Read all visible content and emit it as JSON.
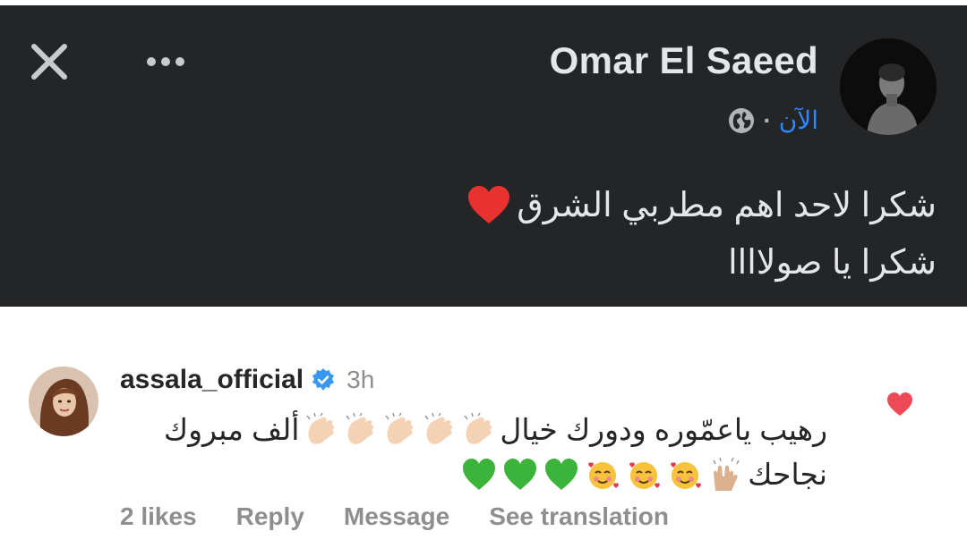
{
  "fb_post": {
    "author": "Omar El Saeed",
    "time": "الآن",
    "separator": "·",
    "line1": "شكرا لاحد اهم مطربي الشرق",
    "line2": "شكرا يا صولاااا",
    "icons": {
      "close": "close-icon",
      "more": "more-icon",
      "privacy": "globe-icon",
      "heart": "red-heart-emoji"
    }
  },
  "comment": {
    "username": "assala_official",
    "time": "3h",
    "line1_text": "رهيب ياعمّوره ودورك خيال",
    "line1_end": "ألف مبروك",
    "line2_text": "نجاحك",
    "clap_count": 5,
    "like_icon": "heart-icon",
    "verified_color": "#3897f0",
    "heart_color": "#ed4956"
  },
  "actions": {
    "likes": "2 likes",
    "reply": "Reply",
    "message": "Message",
    "translate": "See translation"
  },
  "colors": {
    "fb_background": "#242527",
    "fb_text": "#e4e6eb",
    "fb_link": "#2d88ff",
    "ig_text": "#262626",
    "ig_muted": "#8e8e8e"
  }
}
